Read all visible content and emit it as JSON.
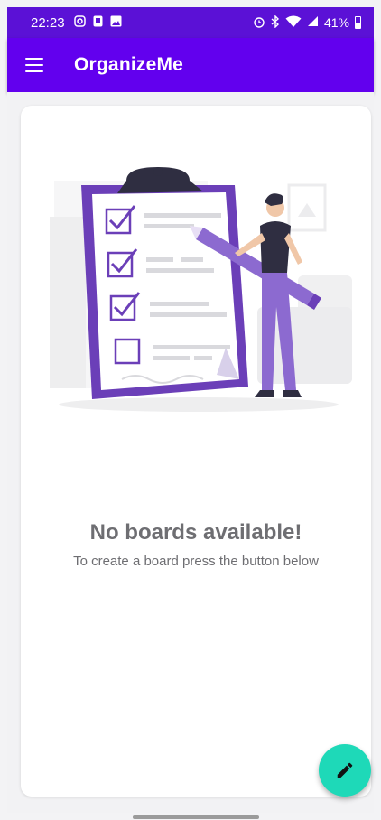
{
  "status_bar": {
    "time": "22:23",
    "battery": "41%",
    "left_icons": [
      "instagram-icon",
      "notification-icon",
      "image-icon"
    ],
    "right_icons": [
      "alarm-icon",
      "bluetooth-icon",
      "wifi-icon",
      "signal-icon",
      "battery-icon"
    ]
  },
  "app_bar": {
    "title": "OrganizeMe",
    "menu_icon": "menu-icon",
    "color": "#6200ee"
  },
  "empty_state": {
    "title": "No boards available!",
    "subtitle": "To create a board press the button below"
  },
  "fab": {
    "icon": "pencil-icon",
    "color": "#1ed9b8"
  },
  "colors": {
    "status_bar": "#5b11d6",
    "accent_purple": "#7b4fc8",
    "text_gray": "#6e6e72"
  }
}
